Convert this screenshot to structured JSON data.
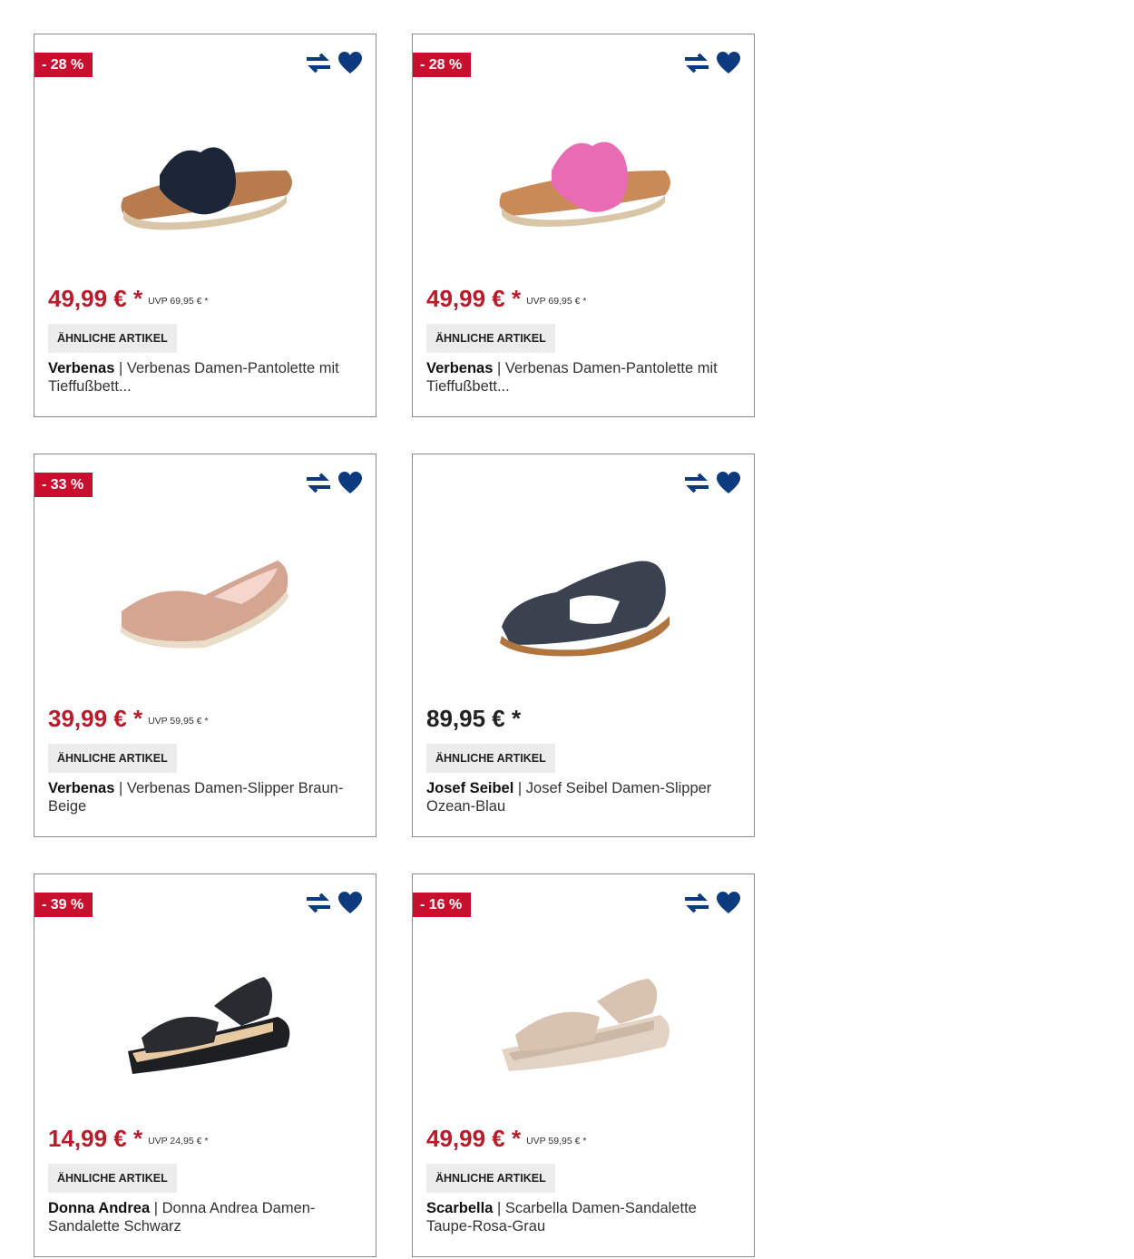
{
  "ui": {
    "similar_label": "ÄHNLICHE ARTIKEL",
    "separator": "|",
    "compare_icon": "compare-arrows-icon",
    "wishlist_icon": "heart-icon",
    "colors": {
      "sale": "#c8102e",
      "price_sale": "#b81c2b",
      "icon": "#0b3a7e",
      "border": "#8c8c8c"
    }
  },
  "products": [
    {
      "badge": "- 28 %",
      "price": "49,99 € *",
      "uvp": "UVP 69,95 € *",
      "brand": "Verbenas",
      "name": "Verbenas Damen-Pantolette mit Tieffußbett...",
      "image": "navy-bow-slide"
    },
    {
      "badge": "- 28 %",
      "price": "49,99 € *",
      "uvp": "UVP 69,95 € *",
      "brand": "Verbenas",
      "name": "Verbenas Damen-Pantolette mit Tieffußbett...",
      "image": "pink-bow-slide"
    },
    {
      "badge": "- 33 %",
      "price": "39,99 € *",
      "uvp": "UVP 59,95 € *",
      "brand": "Verbenas",
      "name": "Verbenas Damen-Slipper Braun-Beige",
      "image": "glitter-espadrille"
    },
    {
      "badge": "",
      "price": "89,95 € *",
      "uvp": "",
      "brand": "Josef Seibel",
      "name": "Josef Seibel Damen-Slipper Ozean-Blau",
      "image": "blue-leather-sandal"
    },
    {
      "badge": "- 39 %",
      "price": "14,99 € *",
      "uvp": "UVP 24,95 € *",
      "brand": "Donna Andrea",
      "name": "Donna Andrea Damen-Sandalette Schwarz",
      "image": "black-wedge-sandal"
    },
    {
      "badge": "- 16 %",
      "price": "49,99 € *",
      "uvp": "UVP 59,95 € *",
      "brand": "Scarbella",
      "name": "Scarbella Damen-Sandalette Taupe-Rosa-Grau",
      "image": "taupe-wedge-sandal"
    }
  ]
}
